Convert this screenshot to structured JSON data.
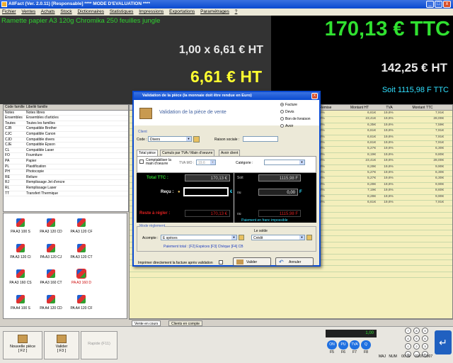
{
  "app": {
    "title": "AllFact (Ver. 2.0.11) [Responsable]     **** MODE D'EVALUATION ****",
    "window_controls": [
      "_",
      "□",
      "x"
    ]
  },
  "menu": [
    "Fichier",
    "Ventes",
    "Achats",
    "Stock",
    "Dictionnaires",
    "Statistiques",
    "Impressions",
    "Exportations",
    "Paramétrages",
    "?"
  ],
  "display": {
    "product": "Ramette papier A3 120g Chromika 250 feuilles jungle",
    "qty_line": "1,00 x 6,61 € HT",
    "total_ht": "6,61 € HT",
    "total_ttc": "170,13 € TTC",
    "net_ht": "142,25 € HT",
    "xpf": "Soit 1115,98 F TTC"
  },
  "families": {
    "headers": [
      "Code famille",
      "Libellé famille"
    ],
    "rows": [
      [
        "Notes",
        "Notes libres"
      ],
      [
        "Ensembles",
        "Ensembles d'articles"
      ],
      [
        "Toutes",
        "Toutes les familles"
      ],
      [
        "CJB",
        "Compatible Brother"
      ],
      [
        "CJC",
        "Compatible Canon"
      ],
      [
        "CJD",
        "Compatible divers"
      ],
      [
        "CJE",
        "Compatible Epson"
      ],
      [
        "CL",
        "Compatible Laser"
      ],
      [
        "FO",
        "Fourniture"
      ],
      [
        "PA",
        "Papier"
      ],
      [
        "PL",
        "Plastification"
      ],
      [
        "PH",
        "Photocopie"
      ],
      [
        "RE",
        "Reliure"
      ],
      [
        "RJ",
        "Remplissage Jet d'encre"
      ],
      [
        "RL",
        "Remplissage Laser"
      ],
      [
        "TT",
        "Transfert Thermique"
      ]
    ]
  },
  "articles": [
    "PA A3 100 S",
    "PA A3 120 CD",
    "PA A3 120 CF",
    "PA A3 120 CI",
    "PA A3 120 CJ",
    "PA A3 120 CT",
    "PA A3 160 CS",
    "PA A3 160 CT",
    "PA A3 160 D",
    "PA A4 100 S",
    "PA A4 120 CD",
    "PA A4 120 CF"
  ],
  "grid": {
    "headers": [
      "Remise",
      "Montant HT",
      "TVA",
      "Montant TTC"
    ],
    "rows": [
      [
        "0,00%",
        "6,61€",
        "19,6%",
        "7,91€"
      ],
      [
        "0,00%",
        "23,41€",
        "19,6%",
        "28,00€"
      ],
      [
        "0,00%",
        "6,35€",
        "19,6%",
        "7,59€"
      ],
      [
        "0,00%",
        "6,61€",
        "19,6%",
        "7,91€"
      ],
      [
        "0,00%",
        "6,61€",
        "19,6%",
        "7,91€"
      ],
      [
        "0,00%",
        "6,61€",
        "19,6%",
        "7,91€"
      ],
      [
        "0,00%",
        "5,27€",
        "19,6%",
        "6,30€"
      ],
      [
        "0,00%",
        "8,19€",
        "19,6%",
        "9,80€"
      ],
      [
        "0,00%",
        "23,41€",
        "19,6%",
        "28,00€"
      ],
      [
        "0,00%",
        "8,28€",
        "19,6%",
        "9,90€"
      ],
      [
        "0,00%",
        "5,27€",
        "19,6%",
        "6,30€"
      ],
      [
        "0,00%",
        "5,27€",
        "19,6%",
        "6,30€"
      ],
      [
        "0,00%",
        "8,28€",
        "19,6%",
        "9,90€"
      ],
      [
        "0,00%",
        "7,19€",
        "19,6%",
        "8,60€"
      ],
      [
        "0,00%",
        "8,28€",
        "19,6%",
        "9,90€"
      ],
      [
        "0,00%",
        "6,61€",
        "19,6%",
        "7,91€"
      ]
    ],
    "tabs": [
      "Vente en cours",
      "Clients en compte"
    ]
  },
  "bottom": {
    "btn_new": "Nouvelle pièce",
    "btn_new_key": "[ F2 ]",
    "btn_validate": "Valider",
    "btn_validate_key": "[ F3 ]",
    "btn_quick": "Rapide (F11)",
    "lcd": "1,00",
    "fkeys": [
      "ON",
      "PU",
      "TVA",
      "Q"
    ],
    "fkey_labels": [
      "F5",
      "F6",
      "F7",
      "F8"
    ],
    "numpad": [
      "7",
      "8",
      "9",
      "4",
      "5",
      "6",
      "1",
      "2",
      "3",
      "0",
      ",",
      "C"
    ],
    "enter": "↵",
    "status": [
      "MAJ",
      "NUM",
      "00:39",
      "01/07/2007"
    ]
  },
  "dialog": {
    "title": "Validation de la pièce (la monnaie doit être rendue en Euro)",
    "header": "Validation de la pièce de vente",
    "doc_types": [
      "Facture",
      "Devis",
      "Bon de livraison",
      "Avoir"
    ],
    "doc_selected": 0,
    "client_group": "Client",
    "code_label": "Code :",
    "code_value": "Divers",
    "raison_label": "Raison sociale :",
    "raison_value": "",
    "tabs": [
      "Total pièce",
      "Cumuls par TVA / Main d'oeuvre",
      "Avoir client"
    ],
    "comptab_label": "Comptabiliser la main d'oeuvre",
    "tva_mo_label": "TVA MO :",
    "tva_mo_value": "19,6",
    "categorie_label": "Catégorie :",
    "total_ttc_label": "Total TTC :",
    "total_ttc_value": "170,13 €",
    "soit_1": "Soit",
    "soit_1_value": "1115,98 F",
    "recu_label": "Reçu :",
    "recu_value": "",
    "recu_unit": "€",
    "ou_1": "ou",
    "recu_f_value": "0,00",
    "recu_f_unit": "F",
    "reste_label": "Reste à régler :",
    "reste_value": "170,13 €",
    "ou_2": "ou",
    "reste_f_value": "1115,98 F",
    "impossible": "Paiement en franc impossible",
    "reglement_group": "Mode règlement",
    "acompte_label": "Acompte :",
    "acompte_value": "E spèces",
    "solde_label": "Le solde",
    "solde_value": "Crédit",
    "total_text": "Paiement total : [F2] Espèces  [F3] Chèque  [F4] CB",
    "print_label": "Imprimer directement la facture après validation",
    "validate_label": "Valider",
    "cancel_label": "Annuler"
  },
  "colors": {
    "ttc": "#30e030",
    "ht": "#ffff30",
    "xpf": "#30e0ff",
    "reste": "#e02020",
    "total_label": "#30d030"
  }
}
